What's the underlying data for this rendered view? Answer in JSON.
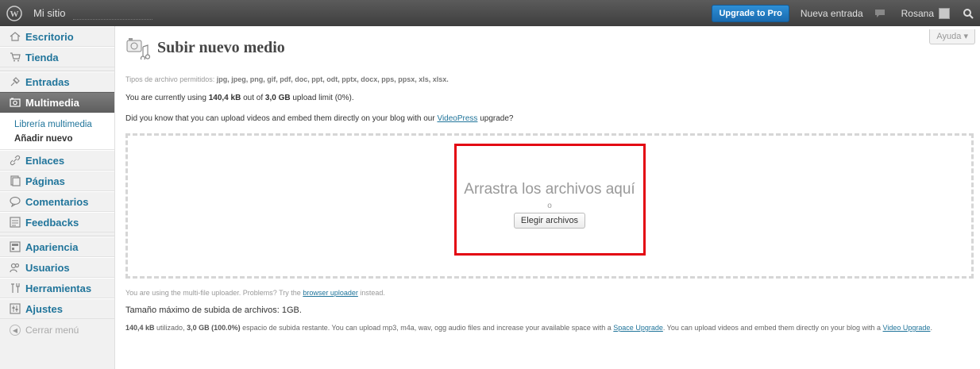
{
  "adminbar": {
    "site_name": "Mi sitio",
    "upgrade_label": "Upgrade to Pro",
    "new_post_label": "Nueva entrada",
    "user_name": "Rosana"
  },
  "sidebar": {
    "items": [
      {
        "label": "Escritorio",
        "icon": "dashboard-icon"
      },
      {
        "label": "Tienda",
        "icon": "cart-icon"
      },
      {
        "label": "Entradas",
        "icon": "pin-icon"
      },
      {
        "label": "Multimedia",
        "icon": "media-icon"
      },
      {
        "label": "Enlaces",
        "icon": "link-icon"
      },
      {
        "label": "Páginas",
        "icon": "page-icon"
      },
      {
        "label": "Comentarios",
        "icon": "comment-icon"
      },
      {
        "label": "Feedbacks",
        "icon": "feedback-icon"
      },
      {
        "label": "Apariencia",
        "icon": "appearance-icon"
      },
      {
        "label": "Usuarios",
        "icon": "users-icon"
      },
      {
        "label": "Herramientas",
        "icon": "tools-icon"
      },
      {
        "label": "Ajustes",
        "icon": "settings-icon"
      }
    ],
    "submenu": {
      "library": "Librería multimedia",
      "add_new": "Añadir nuevo"
    },
    "collapse_label": "Cerrar menú"
  },
  "main": {
    "help_label": "Ayuda ▾",
    "page_title": "Subir nuevo medio",
    "allowed_prefix": "Tipos de archivo permitidos:",
    "allowed_types": "jpg, jpeg, png, gif, pdf, doc, ppt, odt, pptx, docx, pps, ppsx, xls, xlsx.",
    "usage_prefix": "You are currently using",
    "usage_used": "140,4 kB",
    "usage_mid": "out of",
    "usage_limit": "3,0 GB",
    "usage_suffix": "upload limit (0%).",
    "videopress_prefix": "Did you know that you can upload videos and embed them directly on your blog with our",
    "videopress_link": "VideoPress",
    "videopress_suffix": "upgrade?",
    "drop_title": "Arrastra los archivos aquí",
    "drop_or": "o",
    "choose_button": "Elegir archivos",
    "multi_prefix": "You are using the multi-file uploader. Problems? Try the",
    "multi_link": "browser uploader",
    "multi_suffix": "instead.",
    "max_size": "Tamaño máximo de subida de archivos: 1GB.",
    "info_used": "140,4 kB",
    "info_used_suffix": "utilizado,",
    "info_remaining": "3,0 GB (100.0%)",
    "info_text": "espacio de subida restante. You can upload mp3, m4a, wav, ogg audio files and increase your available space with a",
    "info_space_link": "Space Upgrade",
    "info_text2": ". You can upload videos and embed them directly on your blog with a",
    "info_video_link": "Video Upgrade",
    "info_end": "."
  },
  "colors": {
    "link": "#21759b",
    "highlight": "#e30613",
    "adminbar": "#464646"
  }
}
